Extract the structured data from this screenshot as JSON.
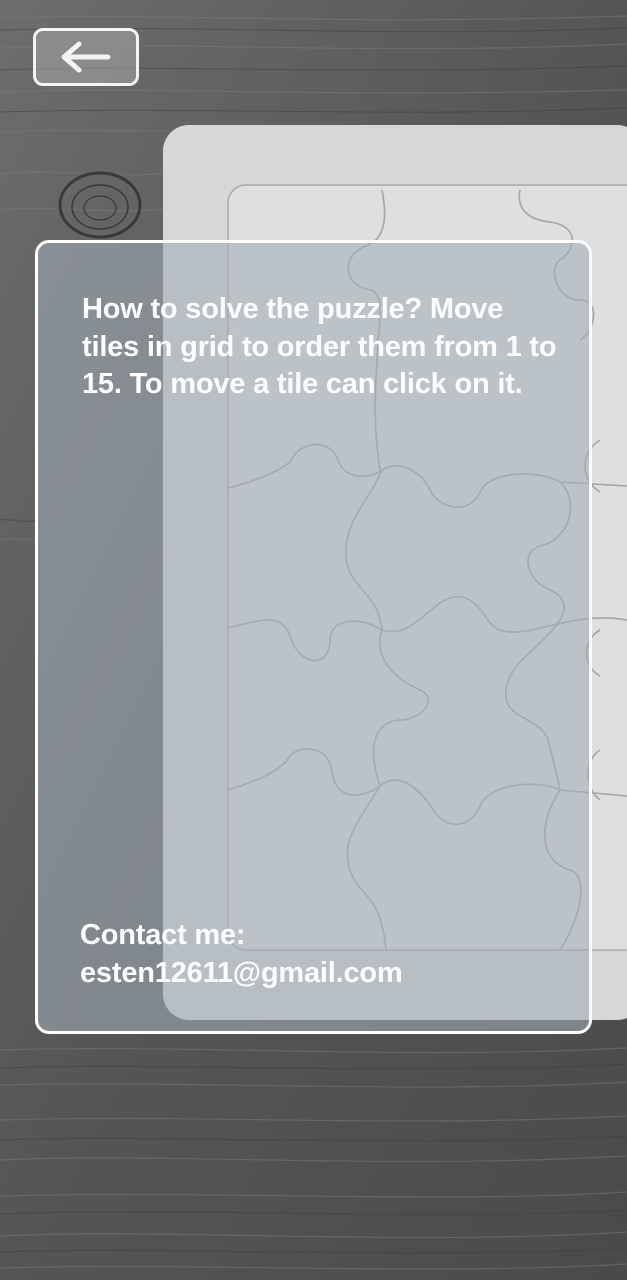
{
  "header": {
    "back_icon": "arrow-left-icon"
  },
  "info": {
    "instructions": "How to solve the puzzle? Move tiles in grid to order them from 1 to 15. To move a tile can click on it.",
    "contact_label": "Contact me:",
    "contact_email": "esten12611@gmail.com"
  },
  "colors": {
    "text": "#ffffff",
    "panel_border": "#ffffff",
    "back_button_border": "#f4f4f4"
  }
}
